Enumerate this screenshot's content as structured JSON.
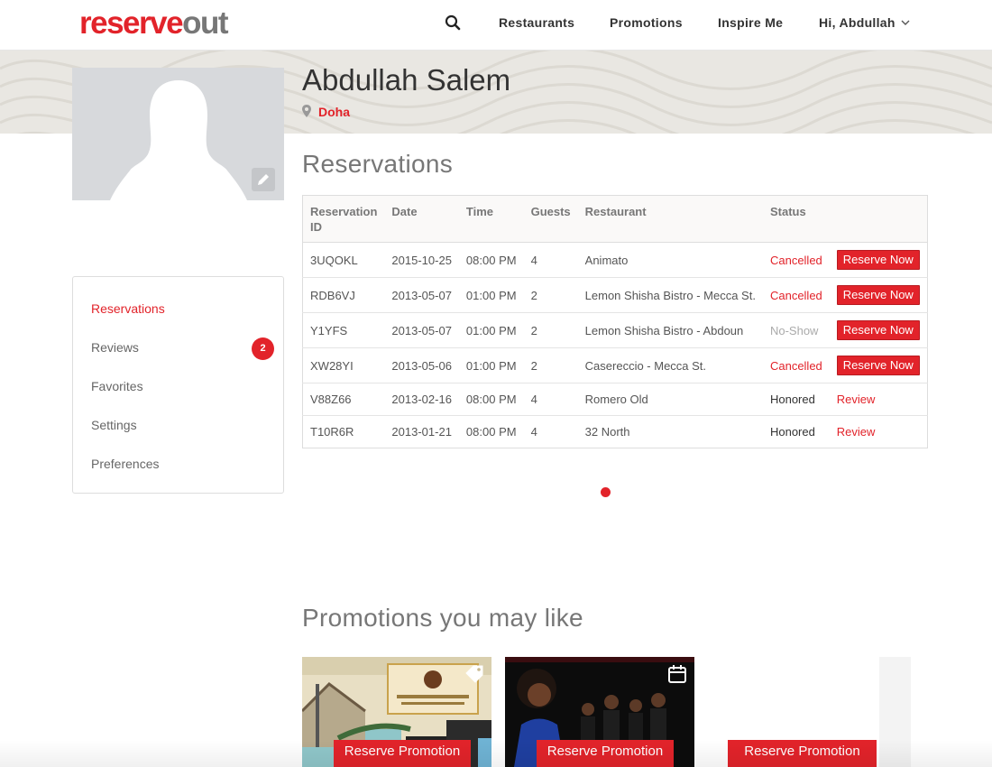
{
  "header": {
    "logo_part1": "reserve",
    "logo_part2": "out",
    "nav": {
      "restaurants": "Restaurants",
      "promotions": "Promotions",
      "inspire": "Inspire Me",
      "user": "Hi, Abdullah"
    },
    "icons": [
      "search-icon",
      "chevron-down-icon"
    ]
  },
  "profile": {
    "name": "Abdullah Salem",
    "city": "Doha",
    "icons": [
      "location-pin-icon",
      "pencil-icon",
      "avatar-placeholder"
    ]
  },
  "sidebar": {
    "items": [
      {
        "label": "Reservations",
        "active": true
      },
      {
        "label": "Reviews",
        "badge": "2"
      },
      {
        "label": "Favorites"
      },
      {
        "label": "Settings"
      },
      {
        "label": "Preferences"
      }
    ]
  },
  "reservations": {
    "title": "Reservations",
    "columns": [
      "Reservation ID",
      "Date",
      "Time",
      "Guests",
      "Restaurant",
      "Status",
      ""
    ],
    "rows": [
      {
        "id": "3UQOKL",
        "date": "2015-10-25",
        "time": "08:00 PM",
        "guests": "4",
        "restaurant": "Animato",
        "status": "Cancelled",
        "action": "Reserve Now"
      },
      {
        "id": "RDB6VJ",
        "date": "2013-05-07",
        "time": "01:00 PM",
        "guests": "2",
        "restaurant": "Lemon Shisha Bistro - Mecca St.",
        "status": "Cancelled",
        "action": "Reserve Now"
      },
      {
        "id": "Y1YFS",
        "date": "2013-05-07",
        "time": "01:00 PM",
        "guests": "2",
        "restaurant": "Lemon Shisha Bistro - Abdoun",
        "status": "No-Show",
        "action": "Reserve Now"
      },
      {
        "id": "XW28YI",
        "date": "2013-05-06",
        "time": "01:00 PM",
        "guests": "2",
        "restaurant": "Casereccio - Mecca St.",
        "status": "Cancelled",
        "action": "Reserve Now"
      },
      {
        "id": "V88Z66",
        "date": "2013-02-16",
        "time": "08:00 PM",
        "guests": "4",
        "restaurant": "Romero Old",
        "status": "Honored",
        "action": "Review"
      },
      {
        "id": "T10R6R",
        "date": "2013-01-21",
        "time": "08:00 PM",
        "guests": "4",
        "restaurant": "32 North",
        "status": "Honored",
        "action": "Review"
      }
    ]
  },
  "promotions": {
    "title": "Promotions you may like",
    "cards": [
      {
        "button": "Reserve Promotion",
        "icon": "tag-icon"
      },
      {
        "button": "Reserve Promotion",
        "icon": "calendar-icon"
      },
      {
        "button": "Reserve Promotion"
      }
    ]
  },
  "colors": {
    "brand": "#e2232a",
    "logo_grey": "#777777",
    "banner": "#e9e7e2",
    "avatar_bg": "#d7d9dc"
  }
}
